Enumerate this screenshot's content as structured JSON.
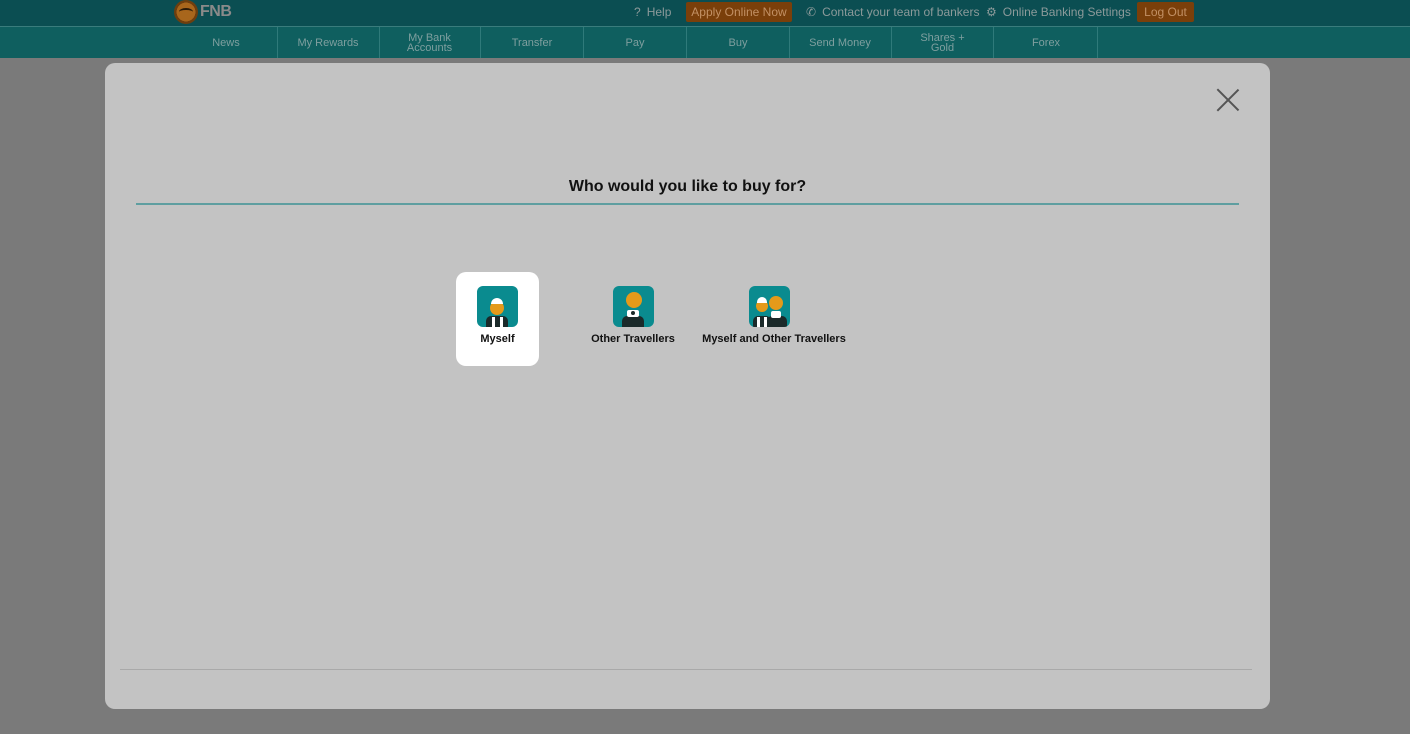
{
  "header": {
    "logo_text": "FNB",
    "help_label": "Help",
    "apply_label": "Apply Online Now",
    "contact_label": "Contact your team of bankers",
    "settings_label": "Online Banking Settings",
    "logout_label": "Log Out",
    "colors": {
      "bar": "#0b4e52",
      "accent": "#7a3f0a"
    }
  },
  "nav": {
    "items": [
      {
        "label": "News"
      },
      {
        "label": "My Rewards"
      },
      {
        "label": "My Bank Accounts"
      },
      {
        "label": "Transfer"
      },
      {
        "label": "Pay"
      },
      {
        "label": "Buy"
      },
      {
        "label": "Send Money"
      },
      {
        "label": "Shares + Gold"
      },
      {
        "label": "Forex"
      }
    ]
  },
  "modal": {
    "title": "Who would you like to buy for?",
    "options": [
      {
        "label": "Myself",
        "icon": "traveller-icon",
        "selected": true
      },
      {
        "label": "Other Travellers",
        "icon": "other-travellers-icon",
        "selected": false
      },
      {
        "label": "Myself and Other Travellers",
        "icon": "myself-and-others-icon",
        "selected": false
      }
    ],
    "colors": {
      "icon_bg": "#0a8b8f",
      "rule": "#5e9ea0"
    }
  }
}
